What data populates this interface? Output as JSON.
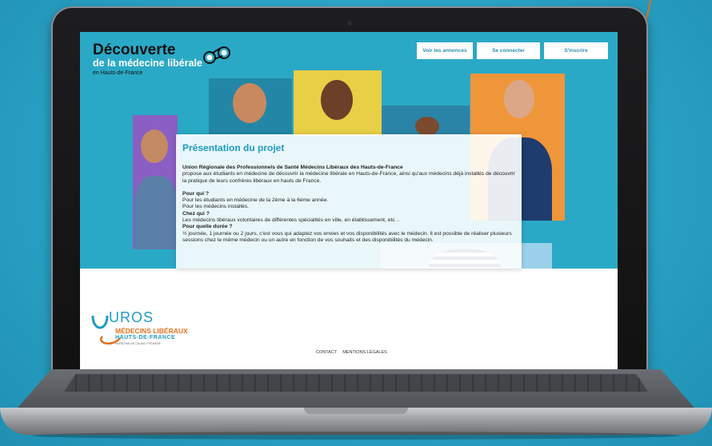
{
  "header": {
    "title_line1": "Découverte",
    "title_line2": "de la médecine libérale",
    "title_line3": "en Hauts-de-France",
    "nav": [
      "Voir les annonces",
      "Se connecter",
      "S'inscrire"
    ]
  },
  "panel": {
    "title": "Présentation du projet",
    "org": "Union Régionale des Professionnels de Santé Médecins Libéraux des Hauts-de-France",
    "intro": "propose aux étudiants en médecine de découvrir la médecine libérale en Hauts-de-France, ainsi qu'aux médecins déjà installés de découvrir la pratique de leurs confrères libéraux en hauts de France.",
    "q1": "Pour qui ?",
    "a1_1": "Pour les étudiants en médecine de la 2ème à la 6ème année.",
    "a1_2": "Pour les médecins installés.",
    "q2": "Chez qui ?",
    "a2": "Les médecins libéraux volontaires de différentes spécialités en ville, en établissement, etc ..",
    "q3": "Pour quelle durée ?",
    "a3": "½ journée, 1 journée ou 2 jours, c'est vous qui adaptez vos envies et vos disponibilités avec le médecin. Il est possible de réaliser plusieurs sessions chez le même médecin ou un autre en fonction de vos souhaits et des disponibilités du médecin."
  },
  "logo": {
    "mark": "UROS",
    "line1": "MÉDECINS LIBÉRAUX",
    "line2": "HAUTS-DE-FRANCE",
    "line3": "NORD-PAS DE CALAIS / PICARDIE"
  },
  "footer": {
    "links": [
      "CONTACT",
      "MENTIONS LÉGALES"
    ]
  },
  "colors": {
    "brand": "#2aa9c6",
    "accent": "#e2701d",
    "title": "#1f9bc4"
  },
  "icons": {
    "binoculars": "binoculars-icon",
    "arrow": "curved-arrow-icon"
  }
}
